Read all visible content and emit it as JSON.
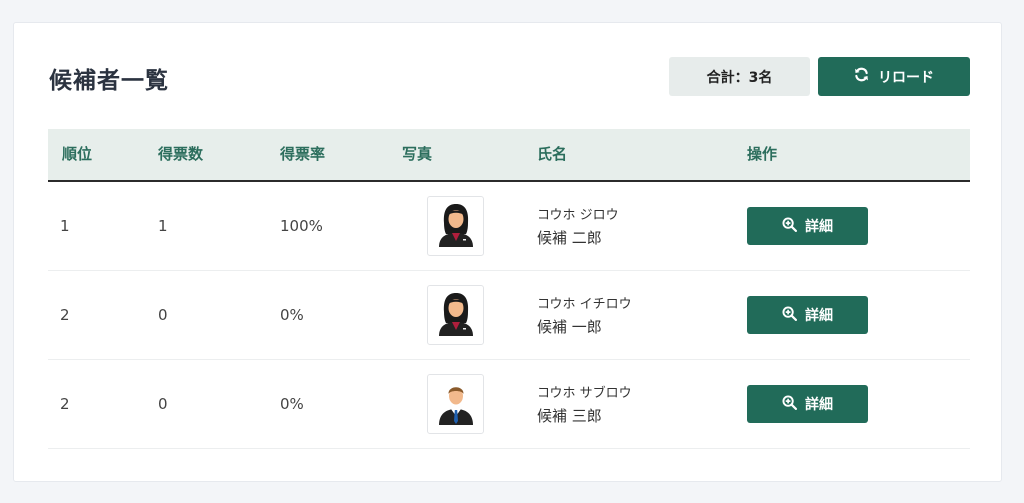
{
  "header": {
    "title": "候補者一覧",
    "total_label": "合計：3名",
    "reload_label": "リロード"
  },
  "table": {
    "columns": [
      "順位",
      "得票数",
      "得票率",
      "写真",
      "氏名",
      "操作"
    ],
    "rows": [
      {
        "rank": "1",
        "votes": "1",
        "rate": "100%",
        "kana": "コウホ ジロウ",
        "name": "候補 二郎",
        "photo_icon": "female-avatar-icon",
        "action": "詳細"
      },
      {
        "rank": "2",
        "votes": "0",
        "rate": "0%",
        "kana": "コウホ イチロウ",
        "name": "候補 一郎",
        "photo_icon": "female-avatar-icon",
        "action": "詳細"
      },
      {
        "rank": "2",
        "votes": "0",
        "rate": "0%",
        "kana": "コウホ サブロウ",
        "name": "候補 三郎",
        "photo_icon": "male-avatar-icon",
        "action": "詳細"
      }
    ]
  },
  "colors": {
    "accent": "#216b59",
    "header_bg": "#e7eeeb",
    "header_text": "#2c6e5d"
  }
}
